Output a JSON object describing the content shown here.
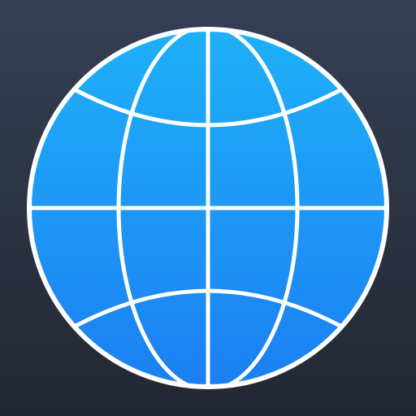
{
  "icon": {
    "name": "globe-icon",
    "colors": {
      "background_top": "#353f55",
      "background_bottom": "#232732",
      "globe_top": "#1eb0f8",
      "globe_bottom": "#1c7ff2",
      "grid_line": "#ffffff"
    }
  }
}
